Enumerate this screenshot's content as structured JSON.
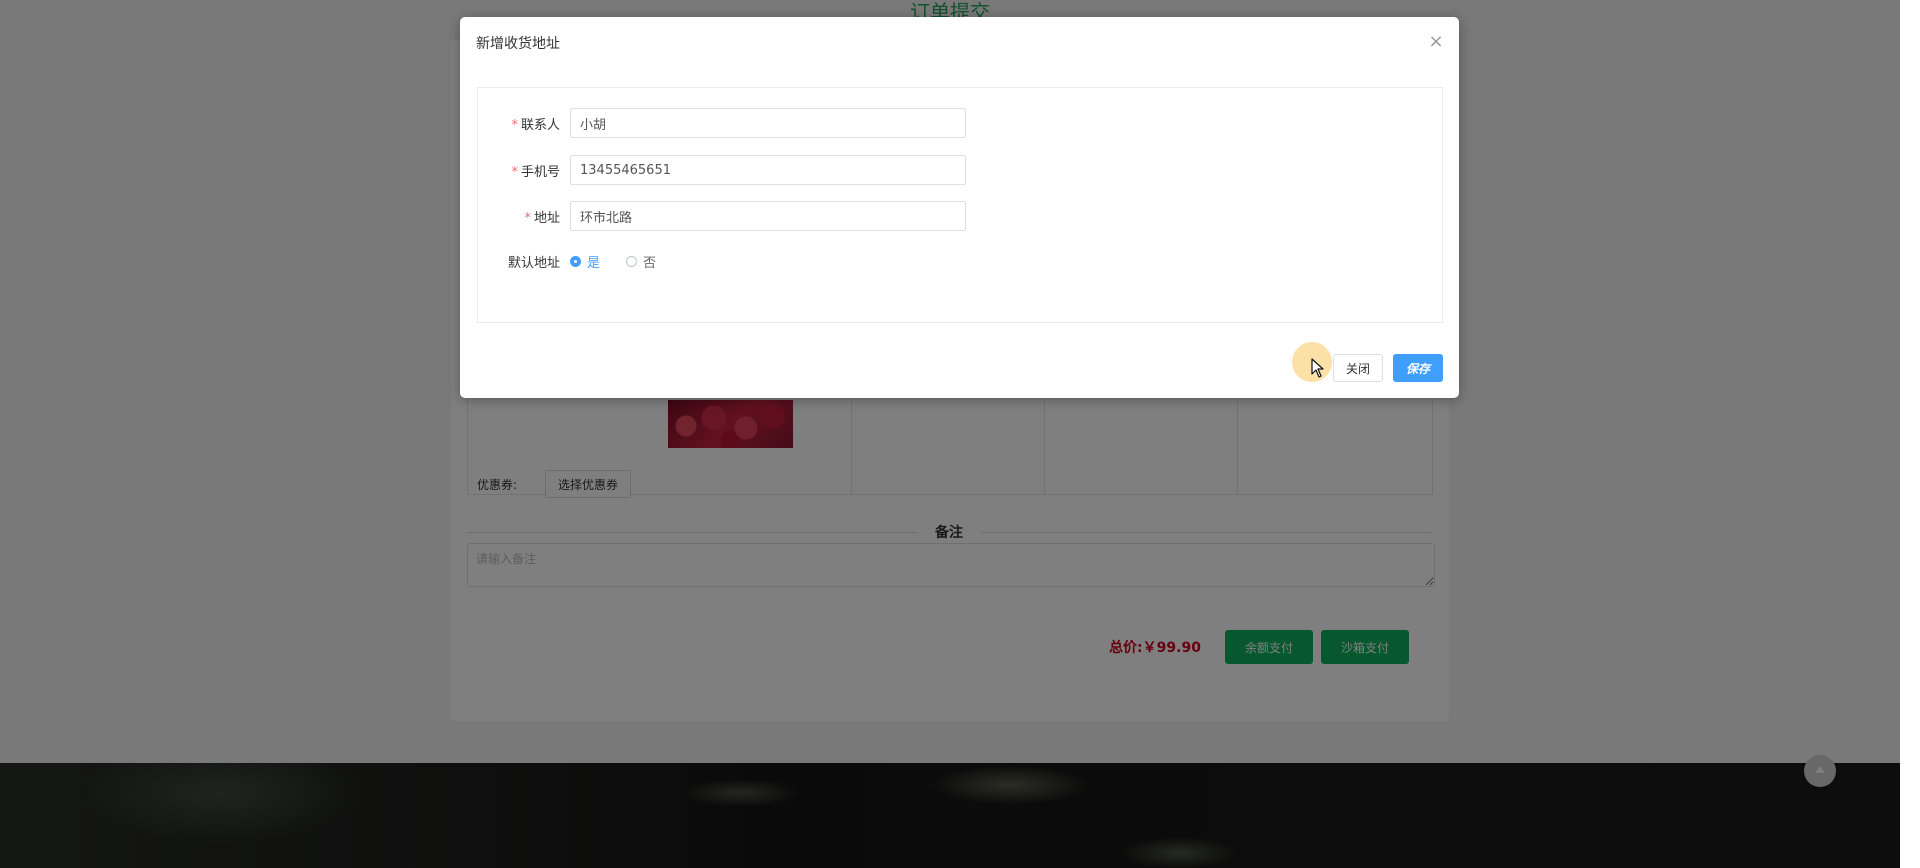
{
  "page": {
    "title": "订单提交",
    "coupon_label": "优惠券:",
    "coupon_button": "选择优惠券",
    "remark_title": "备注",
    "remark_placeholder": "请输入备注",
    "total_label": "总价:",
    "total_value": "￥99.90",
    "pay_balance": "余额支付",
    "pay_sandbox": "沙箱支付"
  },
  "dialog": {
    "title": "新增收货地址",
    "close_symbol": "×",
    "fields": {
      "contact": {
        "label": "联系人",
        "value": "小胡",
        "required": "*"
      },
      "phone": {
        "label": "手机号",
        "value": "13455465651",
        "required": "*"
      },
      "address": {
        "label": "地址",
        "value": "环市北路",
        "required": "*"
      }
    },
    "default_address": {
      "label": "默认地址",
      "options": [
        "是",
        "否"
      ],
      "selected": "是"
    },
    "buttons": {
      "close": "关闭",
      "save": "保存"
    }
  },
  "colors": {
    "primary": "#409eff",
    "green": "#0fb15c",
    "price_red": "#d0001f",
    "required_red": "#f56c6c"
  },
  "icons": {
    "close": "close-icon",
    "back_to_top": "arrow-up-icon",
    "cursor": "mouse-pointer-icon"
  }
}
